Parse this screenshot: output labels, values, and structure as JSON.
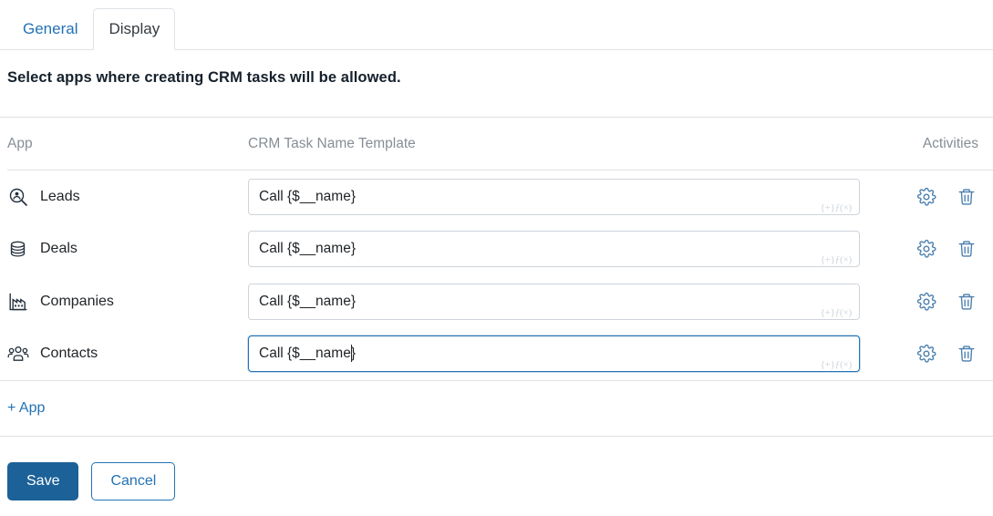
{
  "tabs": [
    {
      "label": "General",
      "active": false
    },
    {
      "label": "Display",
      "active": true
    }
  ],
  "heading": "Select apps where creating CRM tasks will be allowed.",
  "table": {
    "headers": {
      "app": "App",
      "template": "CRM Task Name Template",
      "activities": "Activities"
    },
    "rows": [
      {
        "app": "Leads",
        "icon": "lead-search-icon",
        "template_value": "Call {$__name}",
        "fx_hint": "{+}ƒ(×)",
        "focused": false,
        "settings_icon": "gear-icon",
        "delete_icon": "trash-icon"
      },
      {
        "app": "Deals",
        "icon": "coins-stack-icon",
        "template_value": "Call {$__name}",
        "fx_hint": "{+}ƒ(×)",
        "focused": false,
        "settings_icon": "gear-icon",
        "delete_icon": "trash-icon"
      },
      {
        "app": "Companies",
        "icon": "factory-icon",
        "template_value": "Call {$__name}",
        "fx_hint": "{+}ƒ(×)",
        "focused": false,
        "settings_icon": "gear-icon",
        "delete_icon": "trash-icon"
      },
      {
        "app": "Contacts",
        "icon": "people-group-icon",
        "template_value": "Call {$__name}",
        "fx_hint": "{+}ƒ(×)",
        "focused": true,
        "settings_icon": "gear-icon",
        "delete_icon": "trash-icon"
      }
    ]
  },
  "add_app_label": "+ App",
  "footer": {
    "save_label": "Save",
    "cancel_label": "Cancel"
  },
  "colors": {
    "link": "#2272b4",
    "primary_button": "#1c6298",
    "border": "#dee2e6",
    "input_border": "#ced4da",
    "muted_text": "#868e96",
    "icon_blue": "#4a7fae"
  }
}
